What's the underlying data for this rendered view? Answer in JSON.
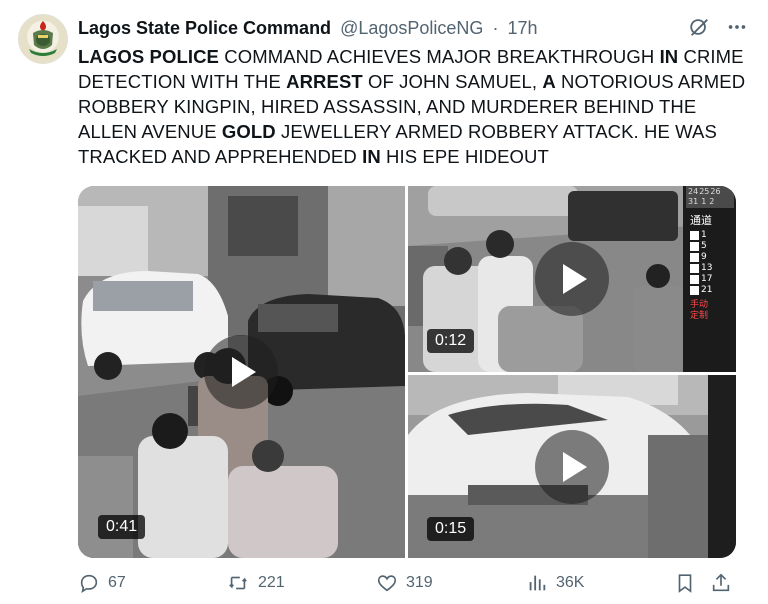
{
  "author": {
    "name": "Lagos State Police Command",
    "handle": "@LagosPoliceNG",
    "separator": "·",
    "time": "17h"
  },
  "tweet_segments": [
    {
      "text": "LAGOS POLICE",
      "bold": true
    },
    {
      "text": " COMMAND ACHIEVES MAJOR BREAKTHROUGH ",
      "bold": false
    },
    {
      "text": "IN",
      "bold": true
    },
    {
      "text": " CRIME DETECTION WITH THE ",
      "bold": false
    },
    {
      "text": "ARREST",
      "bold": true
    },
    {
      "text": " OF JOHN SAMUEL, ",
      "bold": false
    },
    {
      "text": "A",
      "bold": true
    },
    {
      "text": " NOTORIOUS ARMED ROBBERY KINGPIN, HIRED ASSASSIN, AND MURDERER BEHIND THE ALLEN AVENUE ",
      "bold": false
    },
    {
      "text": "GOLD",
      "bold": true
    },
    {
      "text": " JEWELLERY ARMED ROBBERY ATTACK. HE WAS TRACKED AND APPREHENDED ",
      "bold": false
    },
    {
      "text": "IN",
      "bold": true
    },
    {
      "text": " HIS EPE HIDEOUT",
      "bold": false
    }
  ],
  "media": {
    "videos": [
      {
        "duration": "0:41"
      },
      {
        "duration": "0:12"
      },
      {
        "duration": "0:15"
      }
    ],
    "cctv_overlay": {
      "numbers": [
        "24",
        "25",
        "26",
        "31",
        "1",
        "2"
      ],
      "label": "通道",
      "channels": [
        "1",
        "5",
        "9",
        "13",
        "17",
        "21"
      ],
      "button_texts": [
        "手动",
        "定制"
      ]
    }
  },
  "actions": {
    "replies": "67",
    "reposts": "221",
    "likes": "319",
    "views": "36K"
  },
  "colors": {
    "text": "#0f1419",
    "secondary": "#536471",
    "overlay_red": "#d22"
  }
}
